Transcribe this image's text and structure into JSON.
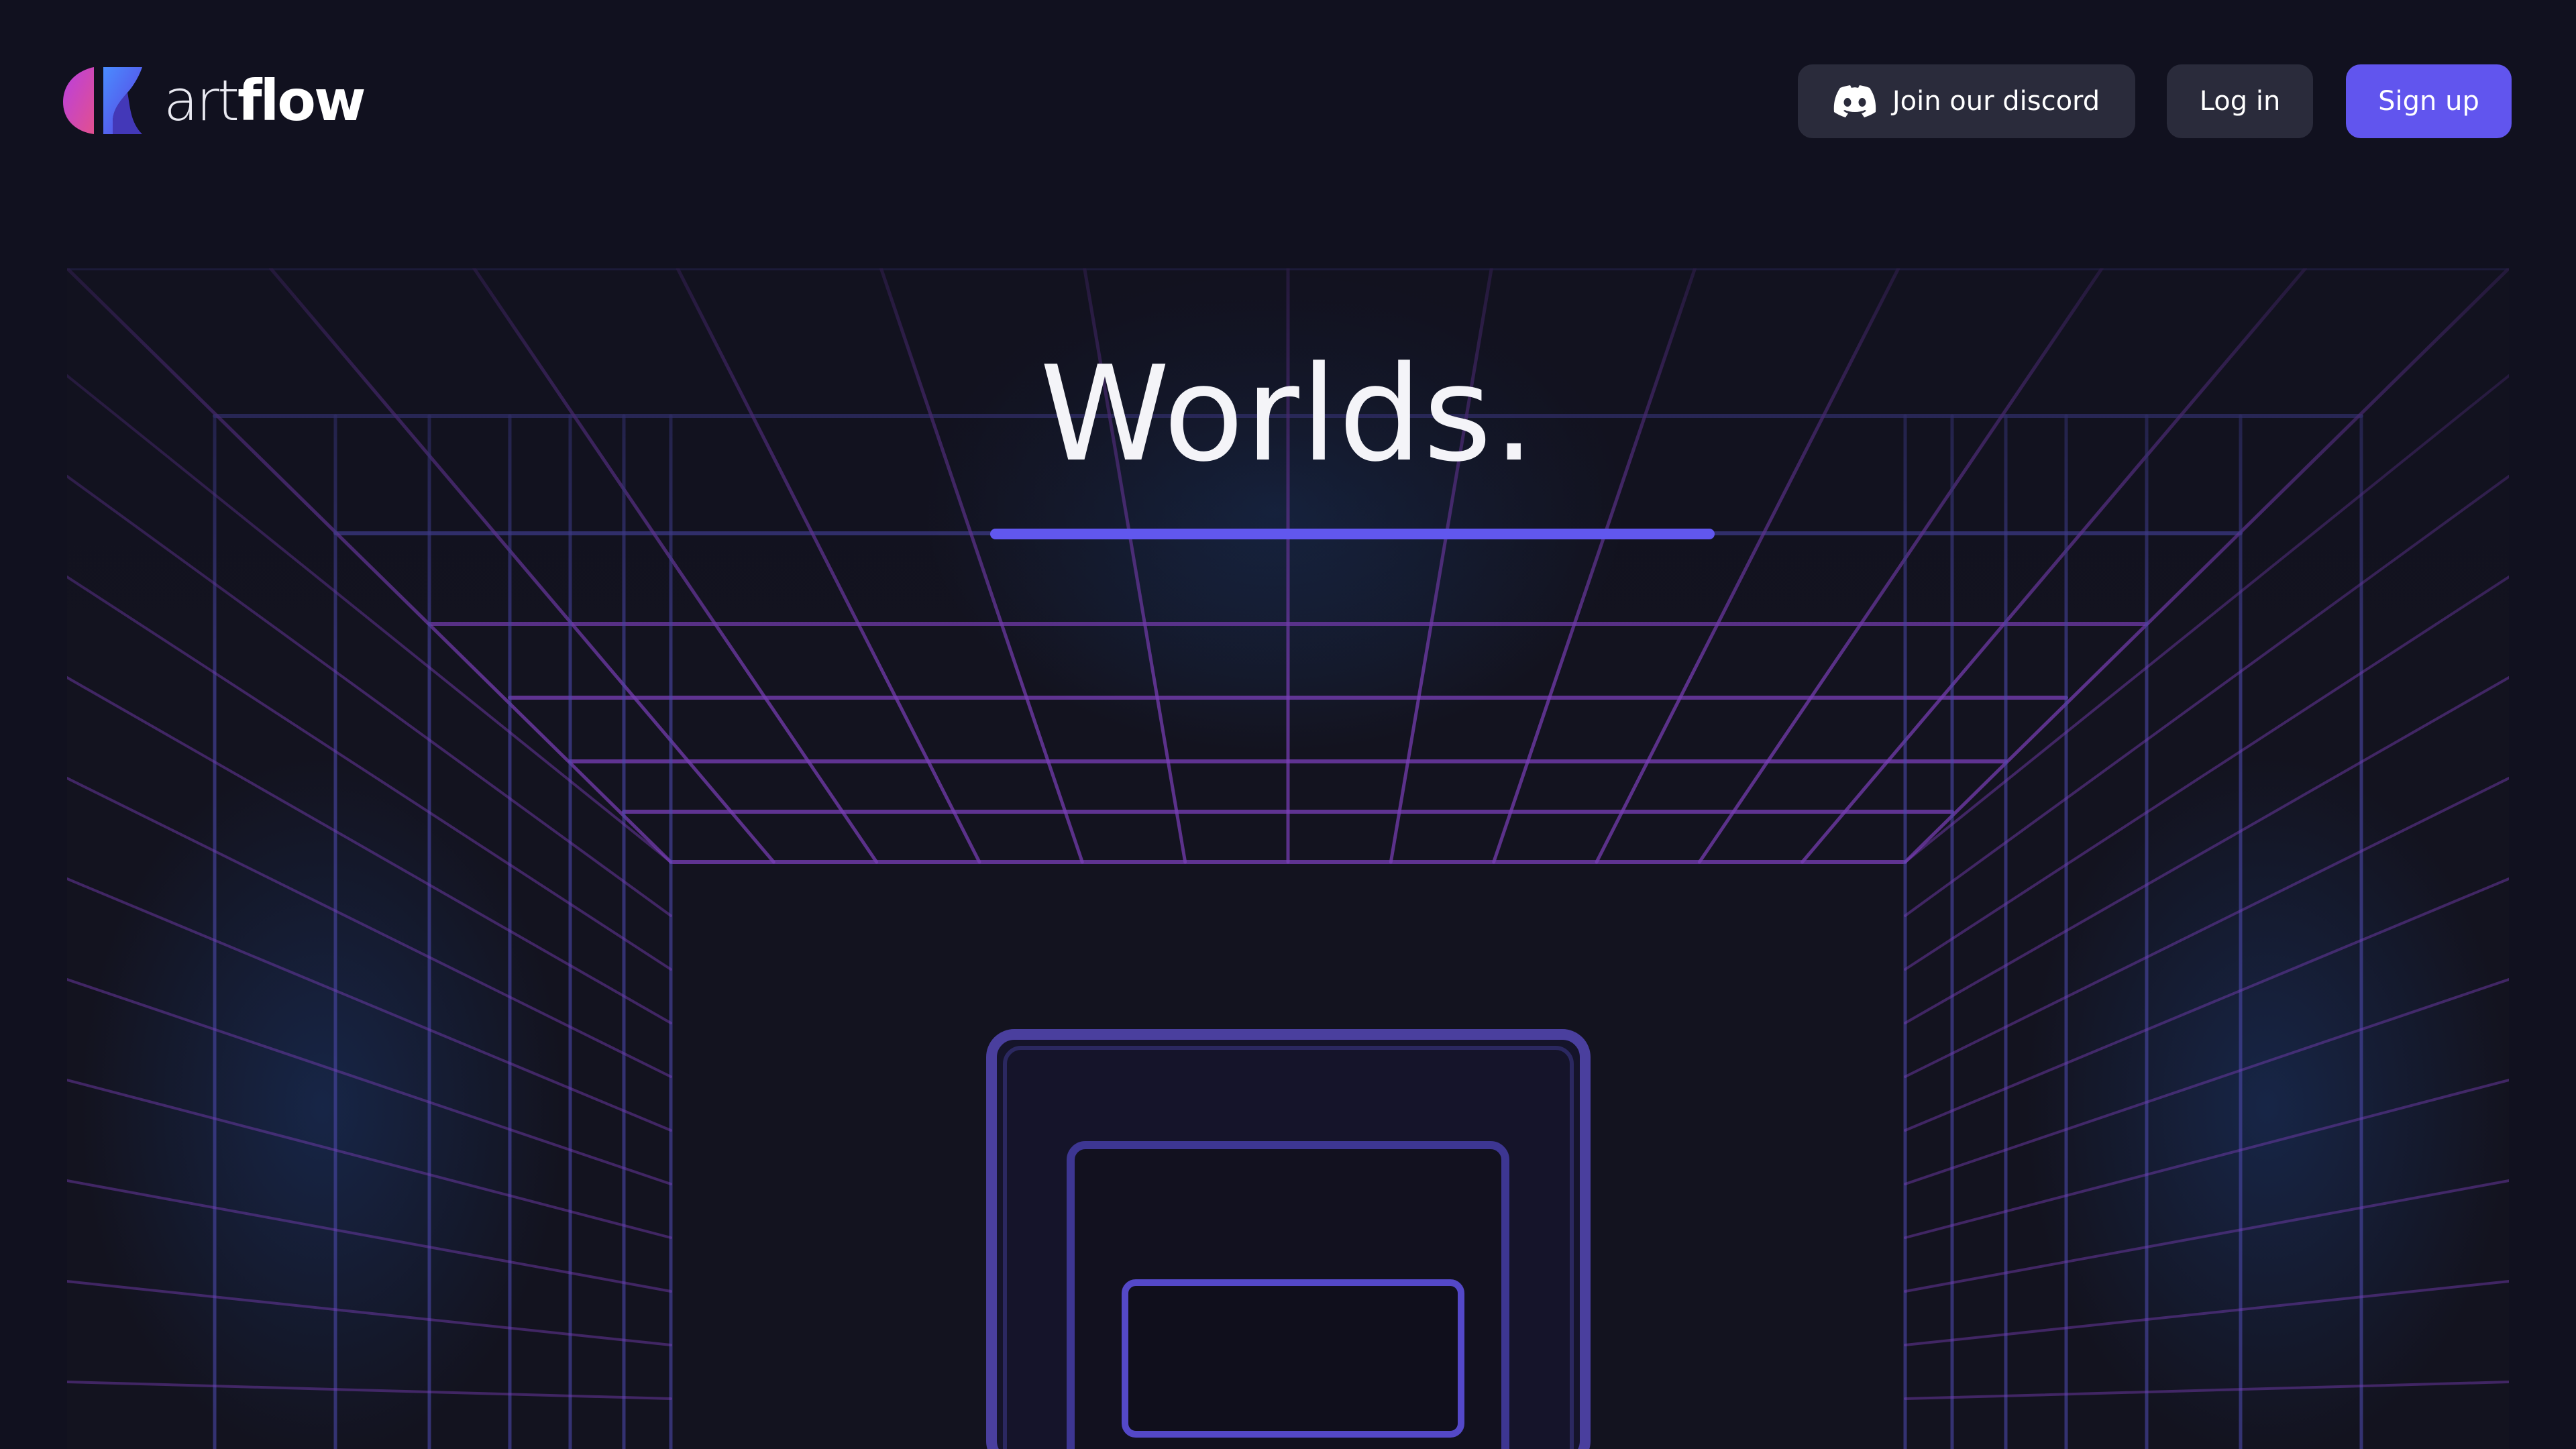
{
  "header": {
    "logo": {
      "name_part1": "art",
      "name_part2": "flow",
      "icon": "artflow-logo-icon"
    },
    "discord_button": {
      "label": "Join our discord",
      "icon": "discord-icon"
    },
    "login_button": {
      "label": "Log in"
    },
    "signup_button": {
      "label": "Sign up"
    }
  },
  "hero": {
    "title": "Worlds."
  },
  "colors": {
    "background": "#11111f",
    "accent": "#6155ee",
    "button_secondary": "#2a2b3b",
    "grid_purple": "#7a3fb8",
    "grid_blue": "#4b47a8",
    "text": "#ffffff"
  }
}
